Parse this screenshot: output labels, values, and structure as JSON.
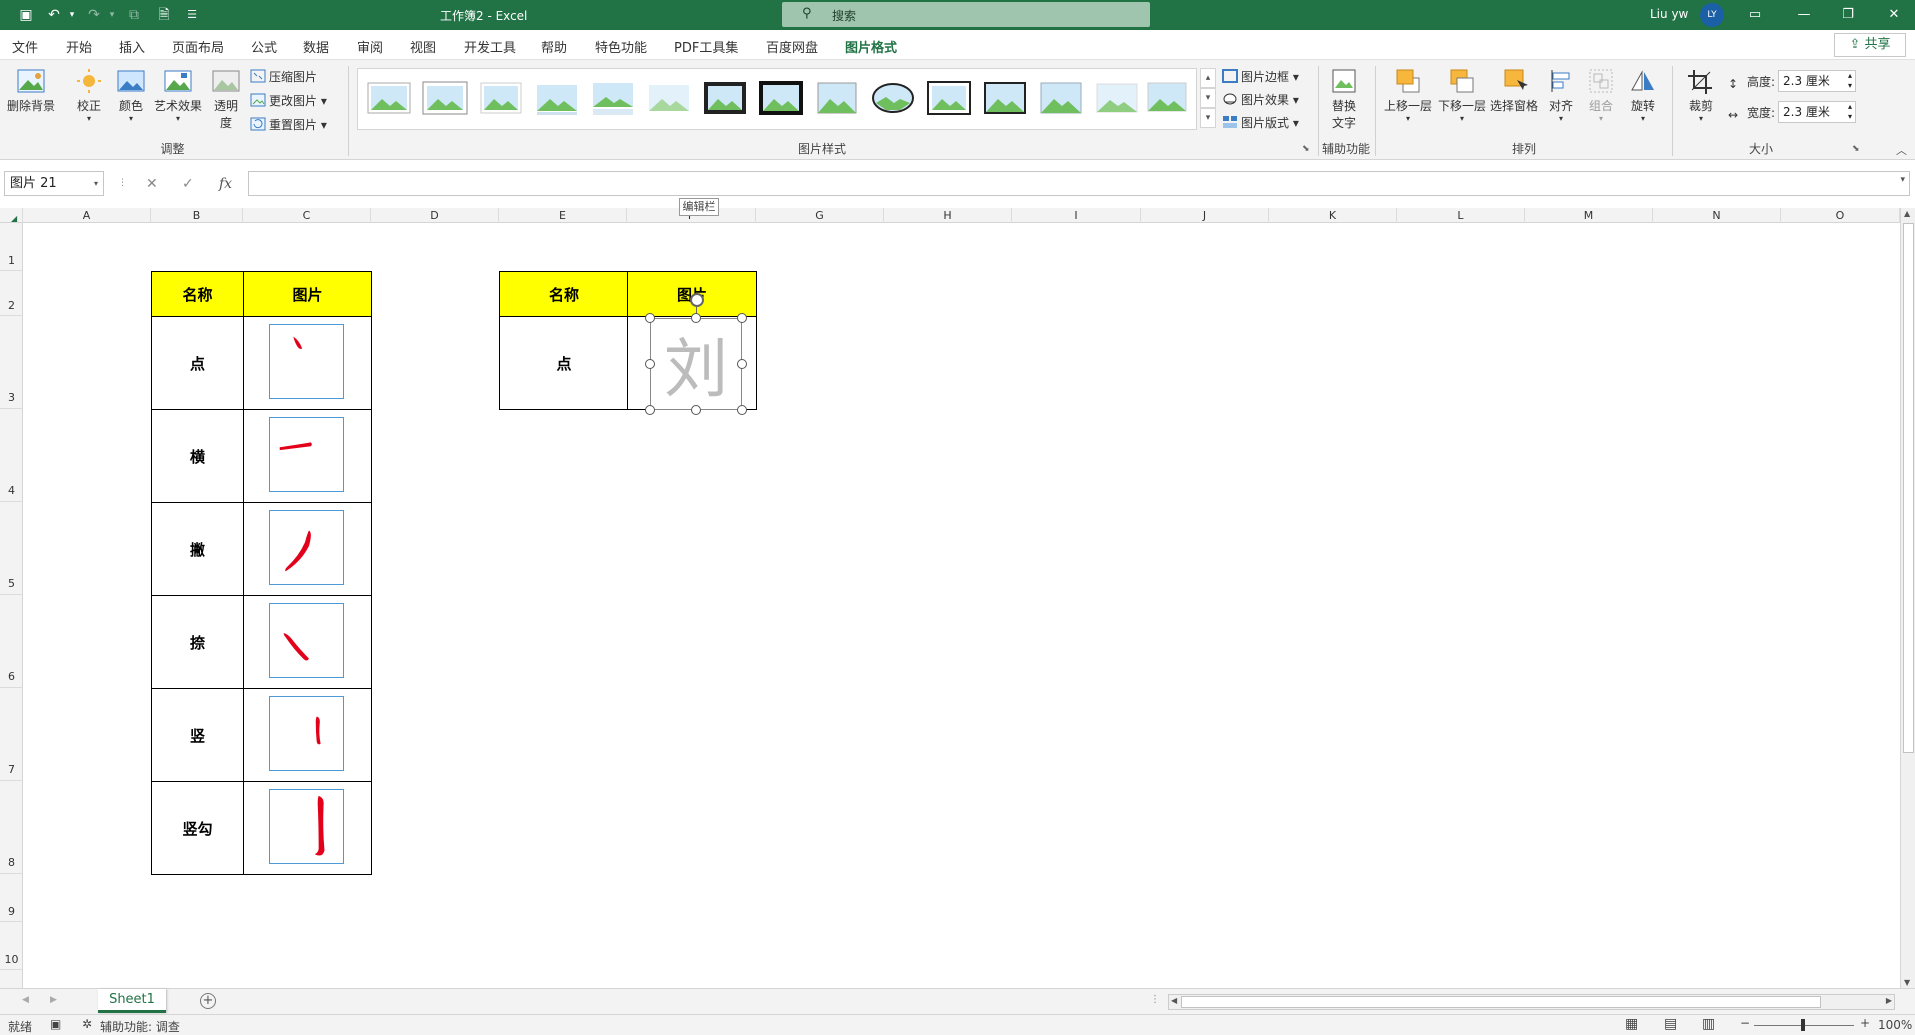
{
  "titlebar": {
    "doc_title": "工作簿2  -  Excel",
    "search_placeholder": "搜索",
    "user_name": "Liu yw",
    "avatar_initials": "LY"
  },
  "menu": {
    "tabs": [
      "文件",
      "开始",
      "插入",
      "页面布局",
      "公式",
      "数据",
      "审阅",
      "视图",
      "开发工具",
      "帮助",
      "特色功能",
      "PDF工具集",
      "百度网盘",
      "图片格式"
    ],
    "active_tab": "图片格式",
    "share": "共享"
  },
  "ribbon": {
    "remove_bg": "删除背景",
    "corrections": "校正",
    "color": "颜色",
    "artistic": "艺术效果",
    "transparency_1": "透明",
    "transparency_2": "度",
    "compress": "压缩图片",
    "change": "更改图片",
    "reset": "重置图片",
    "group_adjust": "调整",
    "border": "图片边框",
    "effects": "图片效果",
    "layout": "图片版式",
    "group_styles": "图片样式",
    "alt_text_1": "替换",
    "alt_text_2": "文字",
    "group_access": "辅助功能",
    "bring_forward": "上移一层",
    "send_backward": "下移一层",
    "selection_pane": "选择窗格",
    "align": "对齐",
    "group_obj": "组合",
    "rotate": "旋转",
    "group_arrange": "排列",
    "crop": "裁剪",
    "height_label": "高度:",
    "height_value": "2.3 厘米",
    "width_label": "宽度:",
    "width_value": "2.3 厘米",
    "group_size": "大小"
  },
  "formula_bar": {
    "name_box": "图片 21",
    "fx": "fx",
    "tooltip": "编辑栏"
  },
  "columns": [
    "A",
    "B",
    "C",
    "D",
    "E",
    "F",
    "G",
    "H",
    "I",
    "J",
    "K",
    "L",
    "M",
    "N",
    "O"
  ],
  "rows": [
    "1",
    "2",
    "3",
    "4",
    "5",
    "6",
    "7",
    "8",
    "9",
    "10"
  ],
  "table1": {
    "header_name": "名称",
    "header_pic": "图片",
    "rows": [
      {
        "name": "点",
        "glyph": "丶"
      },
      {
        "name": "横",
        "glyph": "一"
      },
      {
        "name": "撇",
        "glyph": "丿"
      },
      {
        "name": "捺",
        "glyph": "㇏"
      },
      {
        "name": "竖",
        "glyph": "丨"
      },
      {
        "name": "竖勾",
        "glyph": "亅"
      }
    ]
  },
  "table2": {
    "header_name": "名称",
    "header_pic": "图片",
    "row_name": "点",
    "selected_glyph": "刘"
  },
  "sheet_tab": "Sheet1",
  "status": {
    "ready": "就绪",
    "accessibility": "辅助功能: 调查",
    "zoom": "100%"
  },
  "colors": {
    "accent": "#217346",
    "header_fill": "#ffff00",
    "stroke_red": "#e3001b"
  }
}
